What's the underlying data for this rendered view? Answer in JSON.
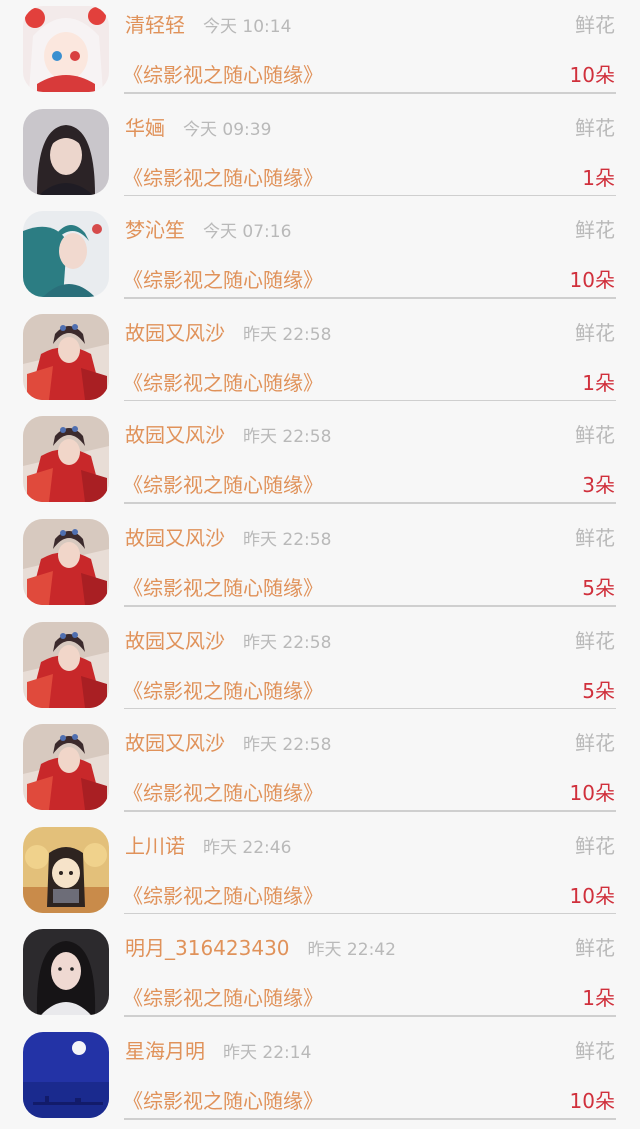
{
  "colors": {
    "background": "#f7f7f7",
    "name": "#e0925a",
    "book": "#e0925a",
    "time": "#b9b9b9",
    "gift": "#b9b9b9",
    "count": "#d0303c",
    "divider": "#cfcfcf"
  },
  "rows": [
    {
      "name": "清轻轻",
      "time": "今天 10:14",
      "gift": "鲜花",
      "book": "《综影视之随心随缘》",
      "count": "10朵",
      "avatar": "anime-girl-avatar"
    },
    {
      "name": "华婳",
      "time": "今天 09:39",
      "gift": "鲜花",
      "book": "《综影视之随心随缘》",
      "count": "1朵",
      "avatar": "girl-photo-avatar"
    },
    {
      "name": "梦沁笙",
      "time": "今天 07:16",
      "gift": "鲜花",
      "book": "《综影视之随心随缘》",
      "count": "10朵",
      "avatar": "teal-girl-avatar"
    },
    {
      "name": "故园又风沙",
      "time": "昨天 22:58",
      "gift": "鲜花",
      "book": "《综影视之随心随缘》",
      "count": "1朵",
      "avatar": "red-costume-avatar"
    },
    {
      "name": "故园又风沙",
      "time": "昨天 22:58",
      "gift": "鲜花",
      "book": "《综影视之随心随缘》",
      "count": "3朵",
      "avatar": "red-costume-avatar"
    },
    {
      "name": "故园又风沙",
      "time": "昨天 22:58",
      "gift": "鲜花",
      "book": "《综影视之随心随缘》",
      "count": "5朵",
      "avatar": "red-costume-avatar"
    },
    {
      "name": "故园又风沙",
      "time": "昨天 22:58",
      "gift": "鲜花",
      "book": "《综影视之随心随缘》",
      "count": "5朵",
      "avatar": "red-costume-avatar"
    },
    {
      "name": "故园又风沙",
      "time": "昨天 22:58",
      "gift": "鲜花",
      "book": "《综影视之随心随缘》",
      "count": "10朵",
      "avatar": "red-costume-avatar"
    },
    {
      "name": "上川诺",
      "time": "昨天 22:46",
      "gift": "鲜花",
      "book": "《综影视之随心随缘》",
      "count": "10朵",
      "avatar": "cartoon-avatar"
    },
    {
      "name": "明月_316423430",
      "time": "昨天 22:42",
      "gift": "鲜花",
      "book": "《综影视之随心随缘》",
      "count": "1朵",
      "avatar": "woman-portrait-avatar"
    },
    {
      "name": "星海月明",
      "time": "昨天 22:14",
      "gift": "鲜花",
      "book": "《综影视之随心随缘》",
      "count": "10朵",
      "avatar": "moon-night-avatar"
    }
  ]
}
